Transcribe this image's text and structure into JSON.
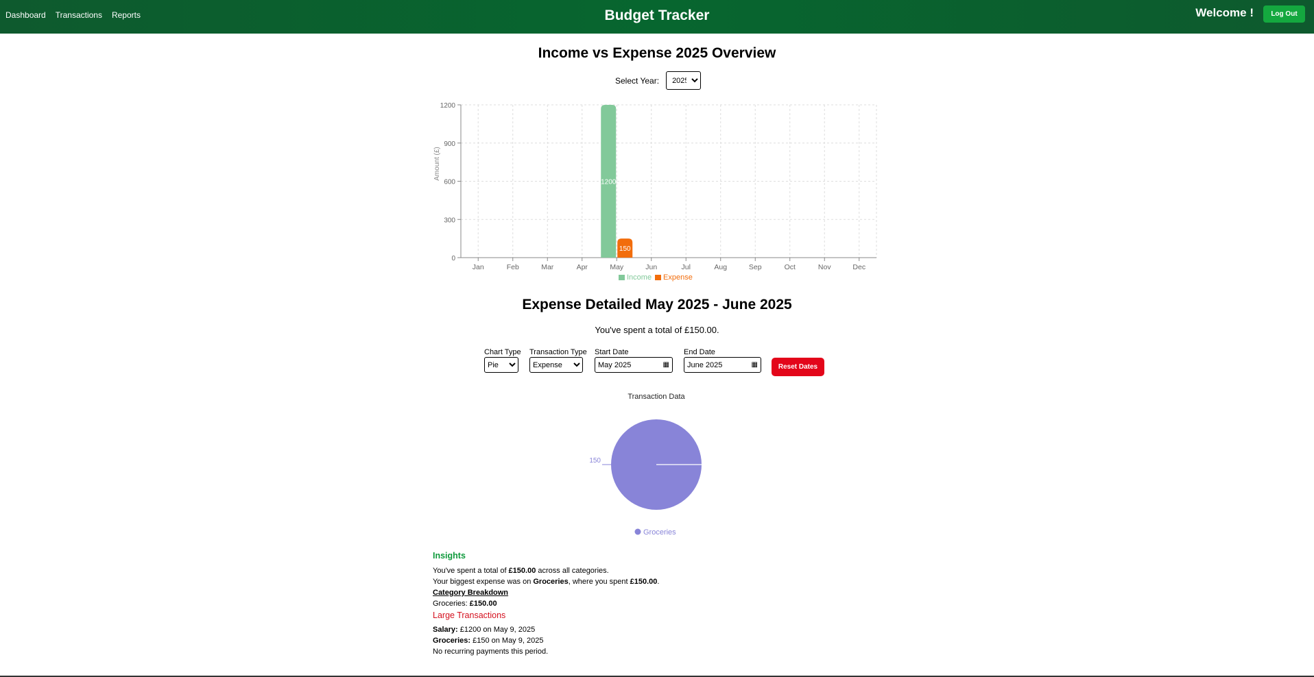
{
  "header": {
    "nav": [
      "Dashboard",
      "Transactions",
      "Reports"
    ],
    "title": "Budget Tracker",
    "welcome": "Welcome !",
    "logout": "Log Out"
  },
  "overview": {
    "title": "Income vs Expense 2025 Overview",
    "select_label": "Select Year:",
    "selected_year": "2025"
  },
  "colors": {
    "income": "#82c99a",
    "expense": "#f26d0c",
    "pie": "#8884d8",
    "header": "#07662f",
    "reset": "#e3061a"
  },
  "chart_data": [
    {
      "type": "bar",
      "ylabel": "Amount (£)",
      "ylim": [
        0,
        1200
      ],
      "yticks": [
        "0",
        "300",
        "600",
        "900",
        "1200"
      ],
      "categories": [
        "Jan",
        "Feb",
        "Mar",
        "Apr",
        "May",
        "Jun",
        "Jul",
        "Aug",
        "Sep",
        "Oct",
        "Nov",
        "Dec"
      ],
      "series": [
        {
          "name": "Income",
          "values": [
            0,
            0,
            0,
            0,
            1200,
            0,
            0,
            0,
            0,
            0,
            0,
            0
          ]
        },
        {
          "name": "Expense",
          "values": [
            0,
            0,
            0,
            0,
            150,
            0,
            0,
            0,
            0,
            0,
            0,
            0
          ]
        }
      ],
      "data_labels": {
        "income_may": "1200",
        "expense_may": "150"
      },
      "grid": true,
      "legend": "bottom"
    },
    {
      "type": "pie",
      "title": "Transaction Data",
      "slices": [
        {
          "name": "Groceries",
          "value": 150,
          "label": "150"
        }
      ],
      "legend": "bottom"
    }
  ],
  "detail": {
    "title": "Expense Detailed May 2025 - June 2025",
    "total_text": "You've spent a total of £150.00.",
    "filters": {
      "chart_type_label": "Chart Type",
      "chart_type_value": "Pie",
      "transaction_type_label": "Transaction Type",
      "transaction_type_value": "Expense",
      "start_label": "Start Date",
      "start_value": "May 2025",
      "end_label": "End Date",
      "end_value": "June 2025",
      "reset": "Reset Dates"
    }
  },
  "insights": {
    "title": "Insights",
    "line1_a": "You've spent a total of ",
    "line1_b": "£150.00",
    "line1_c": " across all categories.",
    "line2_a": "Your biggest expense was on ",
    "line2_b": "Groceries",
    "line2_c": ", where you spent ",
    "line2_d": "£150.00",
    "line2_e": ".",
    "breakdown_title": "Category Breakdown",
    "breakdown_cat": "Groceries: ",
    "breakdown_val": "£150.00",
    "large_title": "Large Transactions",
    "large": [
      {
        "name": "Salary:",
        "text": " £1200 on May 9, 2025"
      },
      {
        "name": "Groceries:",
        "text": " £150 on May 9, 2025"
      }
    ],
    "recurring": "No recurring payments this period."
  }
}
